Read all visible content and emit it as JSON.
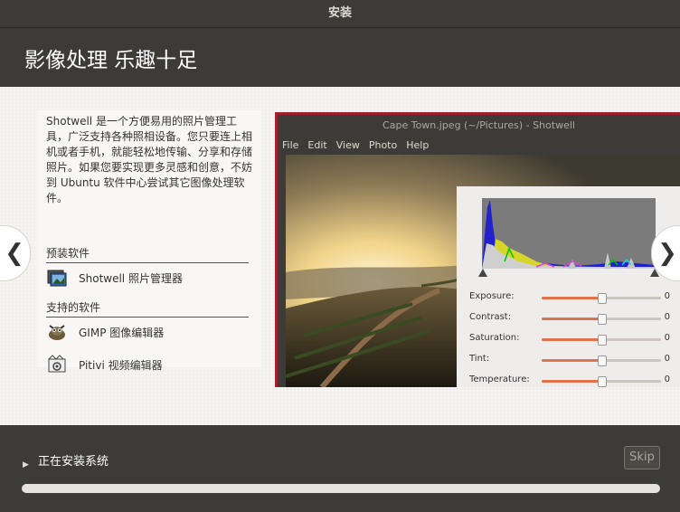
{
  "window": {
    "title": "安装"
  },
  "header": {
    "title": "影像处理 乐趣十足"
  },
  "slide": {
    "description": "Shotwell 是一个方便易用的照片管理工具，广泛支持各种照相设备。您只要连上相机或者手机，就能轻松地传输、分享和存储照片。如果您要实现更多灵感和创意，不妨到 Ubuntu 软件中心尝试其它图像处理软件。",
    "preinstalled_title": "预装软件",
    "preinstalled": [
      {
        "name": "Shotwell 照片管理器",
        "icon": "shotwell-icon"
      }
    ],
    "supported_title": "支持的软件",
    "supported": [
      {
        "name": "GIMP 图像编辑器",
        "icon": "gimp-icon"
      },
      {
        "name": "Pitivi 视频编辑器",
        "icon": "pitivi-icon"
      }
    ],
    "nav_prev": "❮",
    "nav_next": "❯"
  },
  "screenshot": {
    "title": "Cape Town.jpeg (~/Pictures) - Shotwell",
    "menu": [
      "File",
      "Edit",
      "View",
      "Photo",
      "Help"
    ],
    "adjustments": [
      {
        "label": "Exposure:",
        "value": "0",
        "level": 0.5
      },
      {
        "label": "Contrast:",
        "value": "0",
        "level": 0.5
      },
      {
        "label": "Saturation:",
        "value": "0",
        "level": 0.5
      },
      {
        "label": "Tint:",
        "value": "0",
        "level": 0.5
      },
      {
        "label": "Temperature:",
        "value": "0",
        "level": 0.5
      }
    ]
  },
  "footer": {
    "status": "正在安装系统",
    "skip_label": "Skip",
    "progress": 0.0
  },
  "colors": {
    "accent": "#e0734d",
    "frame": "#a11f2f",
    "chrome": "#3c3b37"
  }
}
